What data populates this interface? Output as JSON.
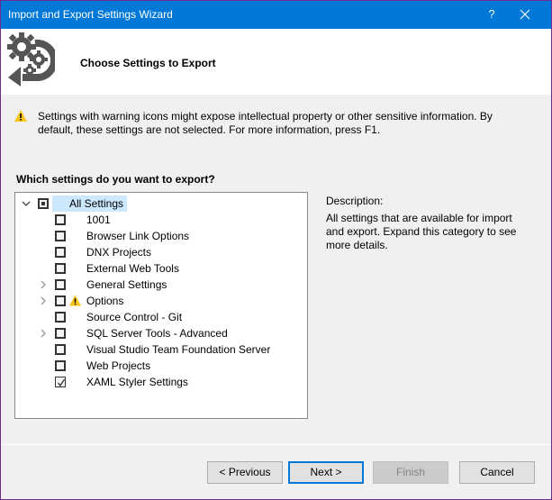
{
  "window": {
    "title": "Import and Export Settings Wizard",
    "help_label": "?",
    "close_icon": "close-icon",
    "border_color": "#6b2c91",
    "titlebar_color": "#0078d7"
  },
  "header": {
    "logo_icon": "gears-export-icon",
    "page_title": "Choose Settings to Export"
  },
  "warning": {
    "icon": "warning-icon",
    "text": "Settings with warning icons might expose intellectual property or other sensitive information. By default, these settings are not selected. For more information, press F1."
  },
  "tree": {
    "question": "Which settings do you want to export?",
    "root": {
      "label": "All Settings",
      "expanded": true,
      "state": "partial",
      "selected": true
    },
    "items": [
      {
        "label": "1001",
        "expandable": false,
        "checked": false,
        "warning": false
      },
      {
        "label": "Browser Link Options",
        "expandable": false,
        "checked": false,
        "warning": false
      },
      {
        "label": "DNX Projects",
        "expandable": false,
        "checked": false,
        "warning": false
      },
      {
        "label": "External Web Tools",
        "expandable": false,
        "checked": false,
        "warning": false
      },
      {
        "label": "General Settings",
        "expandable": true,
        "checked": false,
        "warning": false
      },
      {
        "label": "Options",
        "expandable": true,
        "checked": false,
        "warning": true
      },
      {
        "label": "Source Control - Git",
        "expandable": false,
        "checked": false,
        "warning": false
      },
      {
        "label": "SQL Server Tools - Advanced",
        "expandable": true,
        "checked": false,
        "warning": false
      },
      {
        "label": "Visual Studio Team Foundation Server",
        "expandable": false,
        "checked": false,
        "warning": false
      },
      {
        "label": "Web Projects",
        "expandable": false,
        "checked": false,
        "warning": false
      },
      {
        "label": "XAML Styler Settings",
        "expandable": false,
        "checked": true,
        "warning": false
      }
    ],
    "selection_color": "#cce8ff"
  },
  "description": {
    "title": "Description:",
    "text": "All settings that are available for import and export. Expand this category to see more details."
  },
  "buttons": {
    "previous": "< Previous",
    "next": "Next >",
    "finish": "Finish",
    "cancel": "Cancel",
    "finish_enabled": false,
    "default_button": "next"
  }
}
